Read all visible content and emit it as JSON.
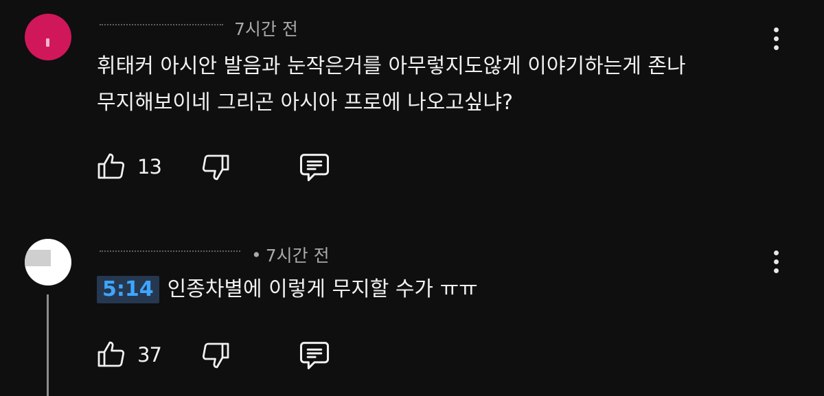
{
  "comments": [
    {
      "author_visible": "",
      "time": "7시간 전",
      "lines": [
        "휘태커 아시안 발음과 눈작은거를 아무렇지도않게 이야기하는게 존나",
        "무지해보이네 그리곤 아시아 프로에 나오고싶냐?"
      ],
      "likes": "13",
      "avatar_color": "#d0175a"
    },
    {
      "author_visible": "",
      "time": "7시간 전",
      "timestamp_link": "5:14",
      "text": "인종차별에 이렇게 무지할 수가 ㅠㅠ",
      "likes": "37",
      "avatar_color": "#ffffff"
    }
  ],
  "icons": {
    "like": "thumbs-up-icon",
    "dislike": "thumbs-down-icon",
    "reply": "reply-comment-icon",
    "more": "more-vertical-icon"
  },
  "colors": {
    "background": "#0f0f0f",
    "timestamp_link": "#3ea6ff",
    "timestamp_bg": "#263850",
    "meta_text": "#aaaaaa"
  }
}
